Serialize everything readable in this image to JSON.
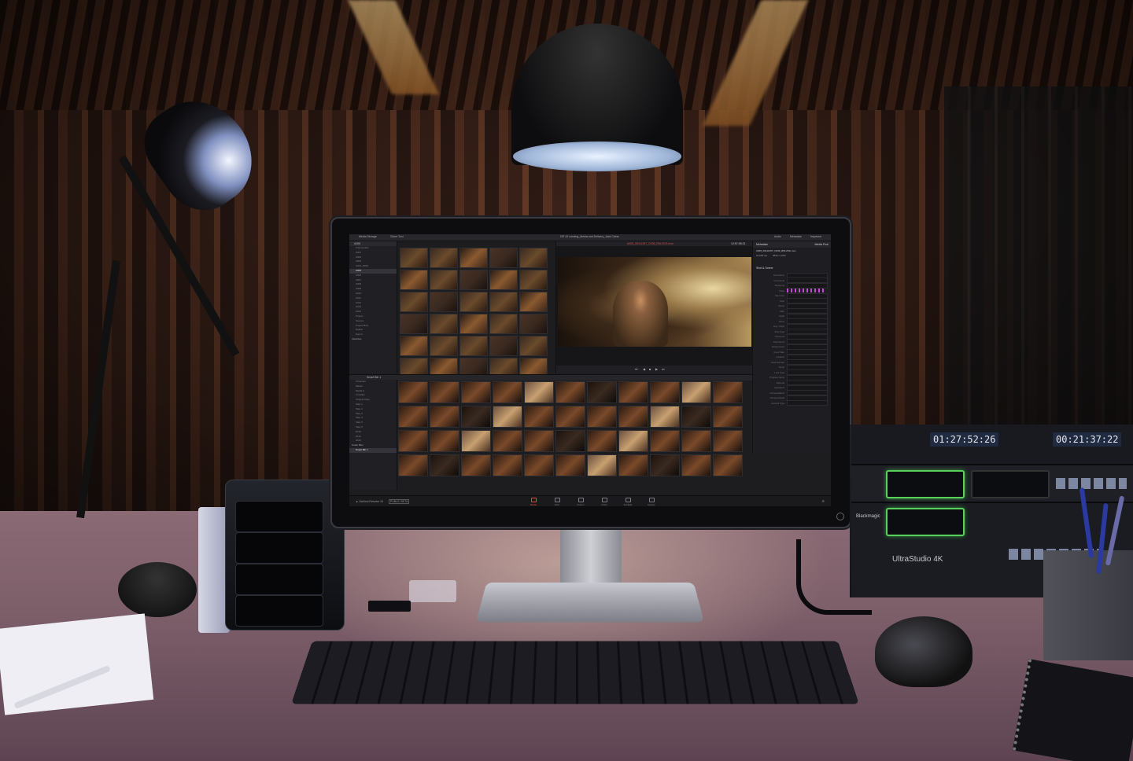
{
  "screen": {
    "topbar": {
      "media_storage_tab": "Media Storage",
      "clone_tab": "Clone Tool",
      "project_title": "DR 15 Landing_Media and Delivery_Jack Caine",
      "audio_tab": "Audio",
      "metadata_tab": "Metadata",
      "inspector_tab": "Inspector"
    },
    "sidebar": {
      "header": "A005",
      "items": [
        "Frameworks",
        "A001",
        "A002",
        "A003",
        "A004_ARRI",
        "A005",
        "A006",
        "A007",
        "A008",
        "A009",
        "A010",
        "A011",
        "A012",
        "A013",
        "A014",
        "Project",
        "Scenes",
        "Project Bins",
        "Dailies",
        "Export"
      ],
      "active_index": 5,
      "favorites_label": "Favorites"
    },
    "viewer": {
      "clip_name": "A005_06111257_C006_R61VDG.mov",
      "timecode": "12:57:08:21"
    },
    "inspector": {
      "header": "Metadata",
      "media_pool_label": "Media Pool",
      "clip_file": "A005_06111257_C006_R61VDG.mov",
      "fps": "24.000 fps",
      "resolution": "3840 x 2160",
      "section_label": "Shot & Scene",
      "fields": [
        "Description",
        "Comments",
        "Keywords",
        "Flags",
        "Clip Color",
        "Shot",
        "Scene",
        "Take",
        "Angle",
        "Move",
        "Day / Night",
        "Shot Type",
        "Camera #",
        "Roll Card #",
        "Environment",
        "Good Take",
        "Location",
        "Reel Number",
        "Setup",
        "Lens Type",
        "Program Name",
        "Episode",
        "Episode #",
        "Camera Manuf",
        "Camera Model",
        "Camera Type"
      ]
    },
    "pool_bar": {
      "smart_bin": "Smart Bin 1"
    },
    "sidebar2": {
      "items": [
        "Timelines",
        "Master",
        "Media A",
        "Circulate",
        "Original Clips",
        "Take 1",
        "Take 2",
        "Take 3",
        "Take 4",
        "Take 5",
        "Take 6",
        "2018",
        "2019",
        "2020"
      ],
      "smart_bins_label": "Smart Bins",
      "smart_bin_item": "Smart Bin 1"
    },
    "bottom": {
      "app_name": "DaVinci Resolve 15",
      "public_beta": "PUBLIC BETA",
      "tabs": [
        "Media",
        "Edit",
        "Fusion",
        "Color",
        "Fairlight",
        "Deliver"
      ],
      "active_tab": "Media"
    }
  },
  "hardware": {
    "rack_timecode_1": "01:27:52:26",
    "rack_timecode_2": "00:21:37:22",
    "rack_brand": "Blackmagic",
    "rack_model": "UltraStudio 4K"
  },
  "colors": {
    "accent_red": "#e04848",
    "slot_green": "#57d35a"
  }
}
